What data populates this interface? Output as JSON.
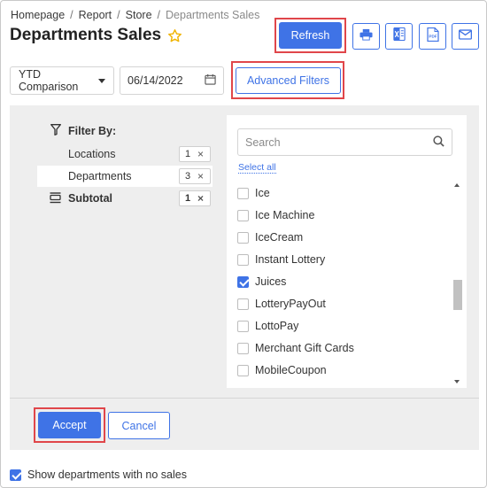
{
  "breadcrumb": {
    "items": [
      "Homepage",
      "Report",
      "Store"
    ],
    "separator": "/",
    "current": "Departments Sales"
  },
  "page": {
    "title": "Departments Sales",
    "favorite_icon": "star-outline-icon"
  },
  "toolbar": {
    "refresh_label": "Refresh",
    "icons": [
      "print-icon",
      "excel-icon",
      "pdf-icon",
      "email-icon"
    ],
    "pdf_text": "PDF"
  },
  "controls": {
    "report_type": "YTD Comparison",
    "date": "06/14/2022",
    "advanced_filters_label": "Advanced Filters"
  },
  "filters": {
    "heading": "Filter By:",
    "rows": [
      {
        "label": "Locations",
        "count": "1"
      },
      {
        "label": "Departments",
        "count": "3",
        "selected": true
      }
    ],
    "subtotal": {
      "label": "Subtotal",
      "count": "1"
    },
    "remove_glyph": "×"
  },
  "list": {
    "search_placeholder": "Search",
    "select_all_label": "Select all",
    "items": [
      {
        "label": "Ice",
        "checked": false
      },
      {
        "label": "Ice Machine",
        "checked": false
      },
      {
        "label": "IceCream",
        "checked": false
      },
      {
        "label": "Instant Lottery",
        "checked": false
      },
      {
        "label": "Juices",
        "checked": true
      },
      {
        "label": "LotteryPayOut",
        "checked": false
      },
      {
        "label": "LottoPay",
        "checked": false
      },
      {
        "label": "Merchant Gift Cards",
        "checked": false
      },
      {
        "label": "MobileCoupon",
        "checked": false
      }
    ]
  },
  "actions": {
    "accept_label": "Accept",
    "cancel_label": "Cancel"
  },
  "footer": {
    "show_no_sales_label": "Show departments with no sales",
    "show_no_sales_checked": true
  },
  "colors": {
    "accent": "#3f73e6",
    "highlight": "#e0464a",
    "star": "#f0b400",
    "panel_bg": "#eeeeee"
  }
}
